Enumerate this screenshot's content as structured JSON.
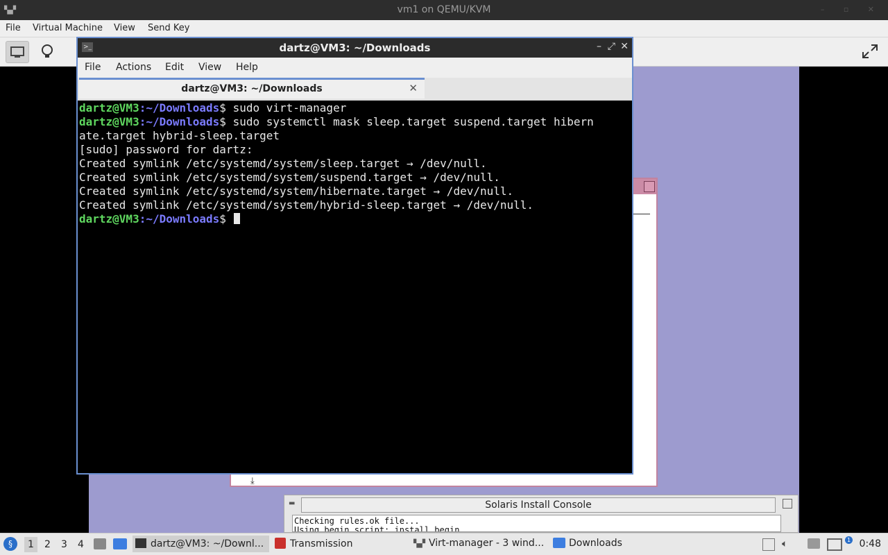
{
  "vm_window": {
    "title": "vm1 on QEMU/KVM",
    "menu": [
      "File",
      "Virtual Machine",
      "View",
      "Send Key"
    ]
  },
  "terminal": {
    "title": "dartz@VM3: ~/Downloads",
    "menu": [
      "File",
      "Actions",
      "Edit",
      "View",
      "Help"
    ],
    "tab_label": "dartz@VM3: ~/Downloads",
    "prompt_user": "dartz@VM3",
    "prompt_path": ":~/Downloads",
    "prompt_symbol": "$",
    "lines": [
      {
        "type": "cmd",
        "text": " sudo virt-manager"
      },
      {
        "type": "cmd",
        "text": " sudo systemctl mask sleep.target suspend.target hibern"
      },
      {
        "type": "out",
        "text": "ate.target hybrid-sleep.target"
      },
      {
        "type": "out",
        "text": "[sudo] password for dartz:"
      },
      {
        "type": "out",
        "text": "Created symlink /etc/systemd/system/sleep.target → /dev/null."
      },
      {
        "type": "out",
        "text": "Created symlink /etc/systemd/system/suspend.target → /dev/null."
      },
      {
        "type": "out",
        "text": "Created symlink /etc/systemd/system/hibernate.target → /dev/null."
      },
      {
        "type": "out",
        "text": "Created symlink /etc/systemd/system/hybrid-sleep.target → /dev/null."
      }
    ]
  },
  "solaris_console": {
    "title": "Solaris Install Console",
    "lines": [
      "Checking rules.ok file...",
      "Using begin script: install_begin"
    ]
  },
  "taskbar": {
    "workspaces": [
      "1",
      "2",
      "3",
      "4"
    ],
    "tasks": [
      {
        "label": "dartz@VM3: ~/Downl...",
        "icon": "terminal-icon"
      },
      {
        "label": "Transmission",
        "icon": "transmission-icon"
      },
      {
        "label": "Virt-manager - 3 wind...",
        "icon": "virt-manager-icon"
      },
      {
        "label": "Downloads",
        "icon": "folder-icon"
      }
    ],
    "clock": "0:48"
  },
  "colors": {
    "terminal_border": "#6a8fd0",
    "prompt_user": "#5fd75f",
    "prompt_path": "#7b7bff",
    "guest_desktop": "#9d9bcf"
  }
}
